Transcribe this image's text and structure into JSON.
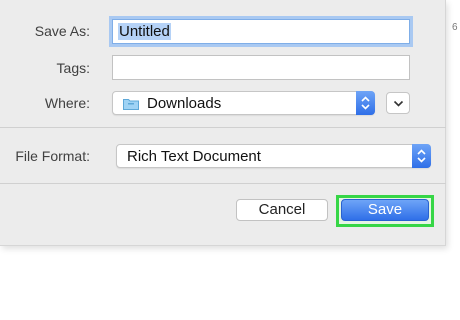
{
  "save_as": {
    "label": "Save As:",
    "value": "Untitled"
  },
  "tags": {
    "label": "Tags:",
    "value": ""
  },
  "where": {
    "label": "Where:",
    "value": "Downloads",
    "icon": "folder-icon"
  },
  "file_format": {
    "label": "File Format:",
    "value": "Rich Text Document"
  },
  "buttons": {
    "cancel": "Cancel",
    "save": "Save"
  },
  "edge_mark": "6",
  "colors": {
    "accent": "#2f6fe8",
    "highlight_ring": "#36d646",
    "focus_ring": "#a9c9f2"
  }
}
